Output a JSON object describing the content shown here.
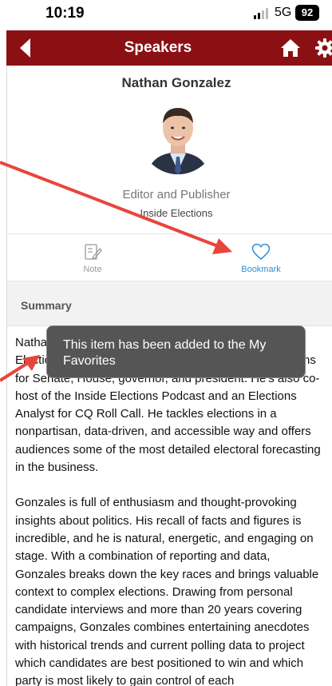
{
  "status_bar": {
    "time": "10:19",
    "network": "5G",
    "battery": "92"
  },
  "nav": {
    "title": "Speakers",
    "back_icon": "chevron-left-icon",
    "home_icon": "home-icon",
    "settings_icon": "gear-icon"
  },
  "speaker": {
    "name": "Nathan Gonzalez",
    "title": "Editor and Publisher",
    "organization": "Inside Elections"
  },
  "actions": {
    "note_label": "Note",
    "bookmark_label": "Bookmark"
  },
  "summary": {
    "heading": "Summary",
    "paragraphs": [
      "Nathan L. Gonzalez is the Editor & Publisher of Inside Elections, a nonpartisan newsletter analyzing campaigns for Senate, House, governor, and president. He's also co-host of the Inside Elections Podcast and an Elections Analyst for CQ Roll Call. He tackles elections in a nonpartisan, data-driven, and accessible way and offers audiences some of the most detailed electoral forecasting in the business.",
      "Gonzales is full of enthusiasm and thought-provoking insights about politics. His recall of facts and figures is incredible, and he is natural, energetic, and engaging on stage. With a combination of reporting and data, Gonzales breaks down the key races and brings valuable context to complex elections. Drawing from personal candidate interviews and more than 20 years covering campaigns, Gonzales combines entertaining anecdotes with historical trends and current polling data to project which candidates are best positioned to win and which party is most likely to gain control of each"
    ]
  },
  "toast": {
    "message": "This item has been added to the My Favorites"
  },
  "colors": {
    "nav_bar": "#8a1014",
    "bookmark_accent": "#2d8fd8",
    "annotation_arrow": "#e8453c"
  }
}
